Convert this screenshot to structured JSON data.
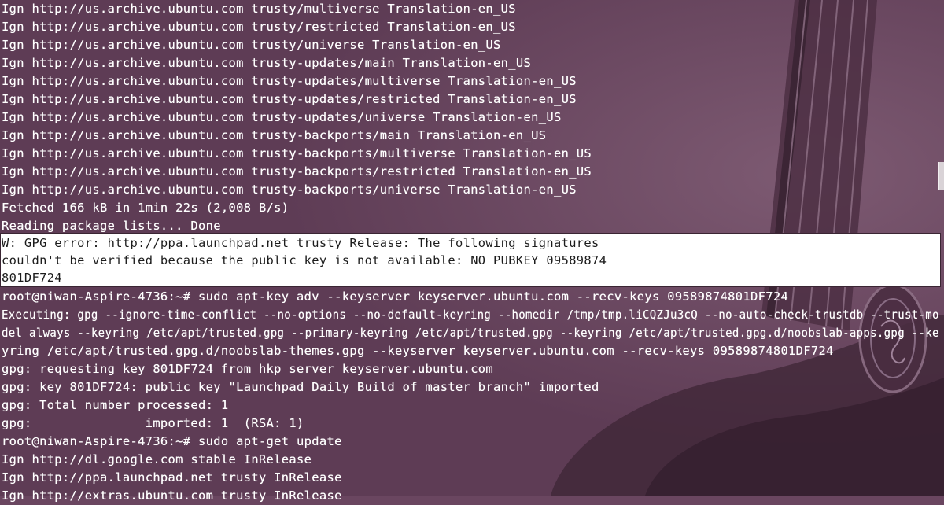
{
  "terminal": {
    "lines": [
      "Ign http://us.archive.ubuntu.com trusty/multiverse Translation-en_US",
      "Ign http://us.archive.ubuntu.com trusty/restricted Translation-en_US",
      "Ign http://us.archive.ubuntu.com trusty/universe Translation-en_US",
      "Ign http://us.archive.ubuntu.com trusty-updates/main Translation-en_US",
      "Ign http://us.archive.ubuntu.com trusty-updates/multiverse Translation-en_US",
      "Ign http://us.archive.ubuntu.com trusty-updates/restricted Translation-en_US",
      "Ign http://us.archive.ubuntu.com trusty-updates/universe Translation-en_US",
      "Ign http://us.archive.ubuntu.com trusty-backports/main Translation-en_US",
      "Ign http://us.archive.ubuntu.com trusty-backports/multiverse Translation-en_US",
      "Ign http://us.archive.ubuntu.com trusty-backports/restricted Translation-en_US",
      "Ign http://us.archive.ubuntu.com trusty-backports/universe Translation-en_US",
      "Fetched 166 kB in 1min 22s (2,008 B/s)",
      "Reading package lists... Done",
      "W: GPG error: http://ppa.launchpad.net trusty Release: The following signatures",
      "couldn't be verified because the public key is not available: NO_PUBKEY 09589874",
      "801DF724",
      "root@niwan-Aspire-4736:~# sudo apt-key adv --keyserver keyserver.ubuntu.com --recv-keys 09589874801DF724",
      "Executing: gpg --ignore-time-conflict --no-options --no-default-keyring --homedir /tmp/tmp.liCQZJu3cQ --no-auto-check-trustdb --trust-mo",
      "del always --keyring /etc/apt/trusted.gpg --primary-keyring /etc/apt/trusted.gpg --keyring /etc/apt/trusted.gpg.d/noobslab-apps.gpg --ke",
      "yring /etc/apt/trusted.gpg.d/noobslab-themes.gpg --keyserver keyserver.ubuntu.com --recv-keys 09589874801DF724",
      "gpg: requesting key 801DF724 from hkp server keyserver.ubuntu.com",
      "gpg: key 801DF724: public key \"Launchpad Daily Build of master branch\" imported",
      "gpg: Total number processed: 1",
      "gpg:               imported: 1  (RSA: 1)",
      "root@niwan-Aspire-4736:~# sudo apt-get update",
      "Ign http://dl.google.com stable InRelease",
      "Ign http://ppa.launchpad.net trusty InRelease",
      "Ign http://extras.ubuntu.com trusty InRelease"
    ],
    "highlighted_lines": [
      13,
      14,
      15
    ]
  },
  "colors": {
    "background": "#6a4660",
    "text": "#ffffff",
    "highlight_background": "#ffffff",
    "highlight_text": "#1c1c1c"
  },
  "icons": {
    "background_image": "acoustic-guitar-wallpaper"
  }
}
